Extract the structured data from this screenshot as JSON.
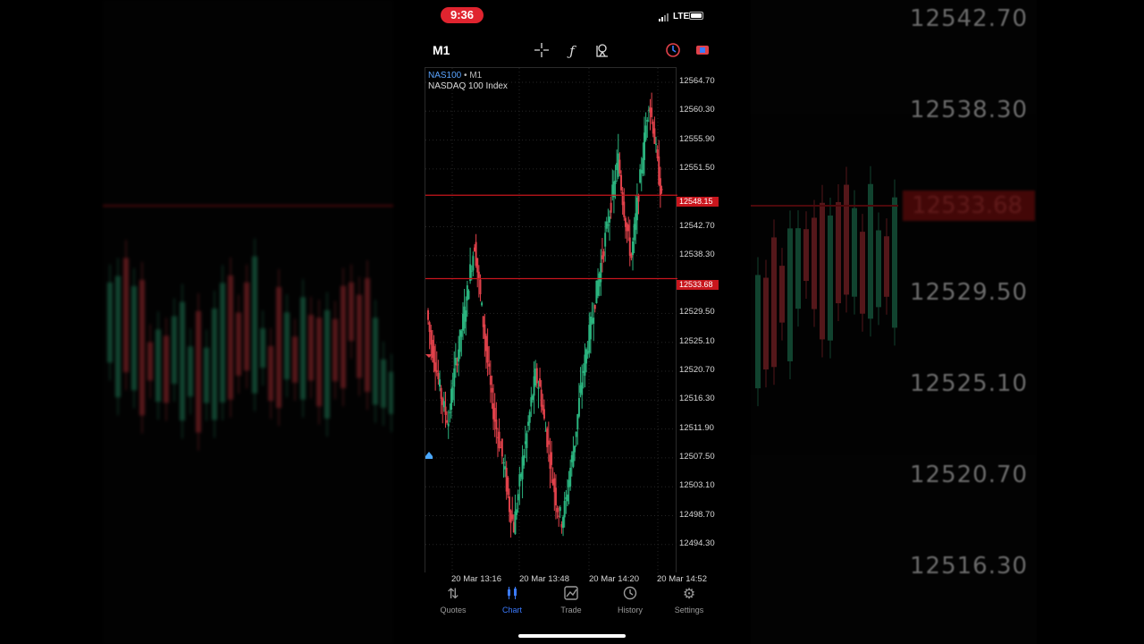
{
  "status_bar": {
    "time": "9:36",
    "network": "LTE"
  },
  "toolbar": {
    "timeframe": "M1"
  },
  "chart": {
    "symbol": "NAS100",
    "timeframe": "M1",
    "description": "NASDAQ 100 Index",
    "bid_price": "12548.15",
    "ask_price": "12533.68",
    "colors": {
      "up": "#2bb37e",
      "down": "#e0414a",
      "line": "#c8161d",
      "grid": "#262626"
    }
  },
  "chart_data": {
    "type": "candlestick",
    "title": "",
    "xlabel": "",
    "ylabel": "",
    "y_ticks": [
      "12564.70",
      "12560.30",
      "12555.90",
      "12551.50",
      "12542.70",
      "12538.30",
      "12529.50",
      "12525.10",
      "12520.70",
      "12516.30",
      "12511.90",
      "12507.50",
      "12503.10",
      "12498.70",
      "12494.30"
    ],
    "x_ticks": [
      "20 Mar 13:16",
      "20 Mar 13:48",
      "20 Mar 14:20",
      "20 Mar 14:52"
    ],
    "ylim": [
      12489.9,
      12569.1
    ],
    "close_series": [
      12530,
      12525,
      12522,
      12518,
      12515,
      12513,
      12519,
      12523,
      12527,
      12531,
      12536,
      12540,
      12534,
      12528,
      12522,
      12516,
      12512,
      12509,
      12505,
      12500,
      12497,
      12502,
      12507,
      12511,
      12516,
      12520,
      12518,
      12513,
      12509,
      12504,
      12500,
      12498,
      12501,
      12506,
      12510,
      12516,
      12521,
      12525,
      12529,
      12533,
      12537,
      12541,
      12545,
      12549,
      12553,
      12547,
      12542,
      12538,
      12544,
      12550,
      12556,
      12562,
      12558,
      12552,
      12547
    ],
    "horizontal_lines": [
      12547.5,
      12534.8
    ]
  },
  "backdrop": {
    "price_labels": [
      "12542.70",
      "12538.30",
      "12529.50",
      "12525.10",
      "12520.70",
      "12516.30"
    ],
    "tag": "12533.68"
  },
  "tabs": [
    {
      "label": "Quotes",
      "icon": "quotes-icon"
    },
    {
      "label": "Chart",
      "icon": "chart-icon"
    },
    {
      "label": "Trade",
      "icon": "trade-icon"
    },
    {
      "label": "History",
      "icon": "history-icon"
    },
    {
      "label": "Settings",
      "icon": "settings-icon"
    }
  ]
}
